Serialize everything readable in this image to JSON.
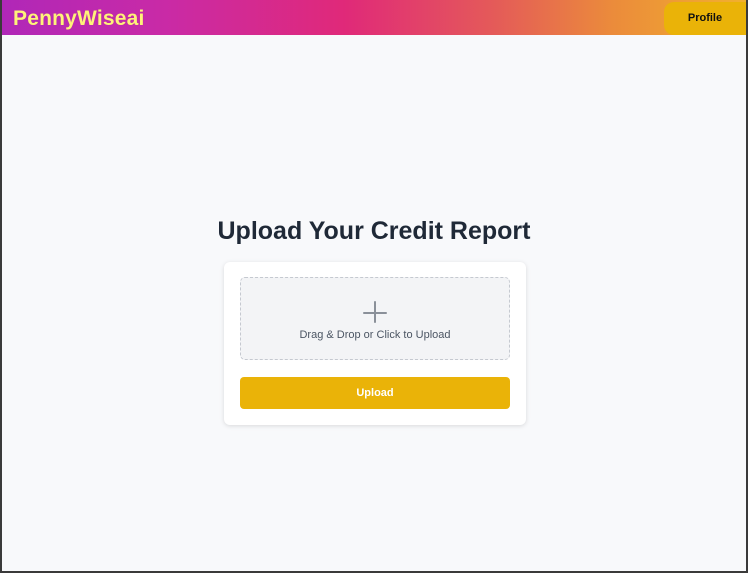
{
  "header": {
    "brand": "PennyWiseai",
    "profile_label": "Profile"
  },
  "main": {
    "title": "Upload Your Credit Report",
    "dropzone": {
      "icon": "plus-icon",
      "label": "Drag & Drop or Click to Upload"
    },
    "upload_label": "Upload"
  },
  "colors": {
    "accent": "#eab308",
    "brand_text": "#fff27a",
    "title_text": "#1f2937",
    "gradient": [
      "#b027b8",
      "#e02979",
      "#f1b02e"
    ]
  }
}
